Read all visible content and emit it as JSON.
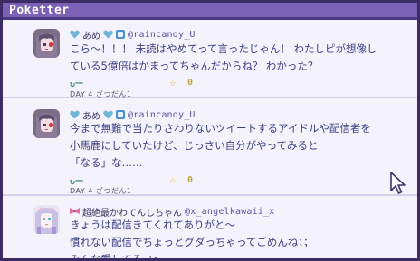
{
  "app": {
    "title": "Poketter"
  },
  "posts": [
    {
      "handle": "@raincandy_U",
      "name": "あめ",
      "text": "こら～！！！ 未読はやめてって言ったじゃん！ わたしピが想像し\nている5億倍はかまってちゃんだからね？ わかった？",
      "rt_label": "↻ー",
      "fav_count": "0",
      "meta": "DAY 4 ざつだん1"
    },
    {
      "handle": "@raincandy_U",
      "name": "あめ",
      "text": "今まで無難で当たりさわりないツイートするアイドルや配信者を\n小馬鹿にしていたけど、じっさい自分がやってみると\n「なる」な……",
      "rt_label": "↻ー",
      "fav_count": "0",
      "meta": "DAY 4 ざつだん1"
    },
    {
      "handle": "@x_angelkawaii_x",
      "name": "超絶最かわてんしちゃん",
      "text": "きょうは配信きてくれてありがと～\n慣れない配信でちょっとグダっちゃってごめんね；；\nみんな愛してるヨ～",
      "rt_label": "",
      "fav_count": "",
      "meta": ""
    }
  ],
  "colors": {
    "accent": "#7b62b7",
    "text": "#3c3f84",
    "handle": "#5a57a3",
    "heart": "#6fb7d8"
  }
}
